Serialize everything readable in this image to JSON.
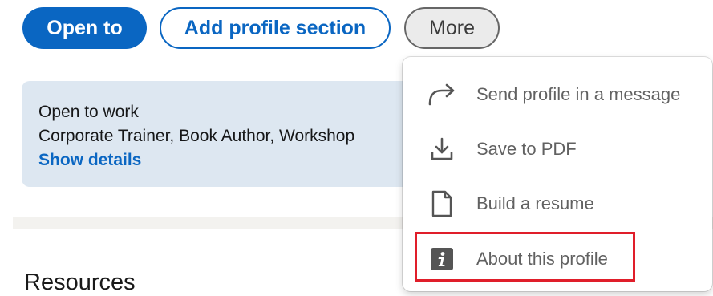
{
  "actions": {
    "open_to": "Open to",
    "add_section": "Add profile section",
    "more": "More"
  },
  "open_to_work": {
    "title": "Open to work",
    "roles": "Corporate Trainer, Book Author, Workshop",
    "show_details": "Show details"
  },
  "section": {
    "resources": "Resources"
  },
  "more_menu": {
    "items": [
      {
        "label": "Send profile in a message",
        "icon": "share-arrow-icon"
      },
      {
        "label": "Save to PDF",
        "icon": "download-icon"
      },
      {
        "label": "Build a resume",
        "icon": "document-icon"
      },
      {
        "label": "About this profile",
        "icon": "info-icon"
      }
    ]
  },
  "colors": {
    "brand_blue": "#0a66c2",
    "card_bg": "#dde7f1",
    "highlight_red": "#e01e2a"
  }
}
